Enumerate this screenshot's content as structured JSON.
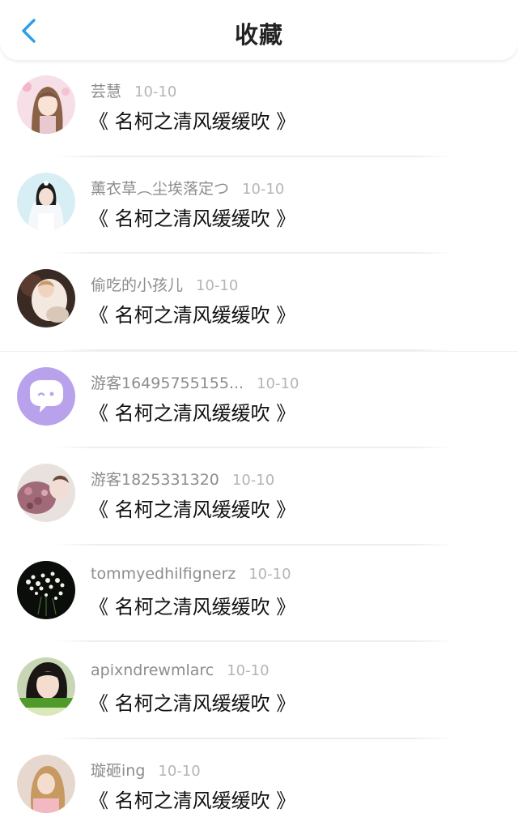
{
  "header": {
    "title": "收藏",
    "back_icon": "chevron-left-icon",
    "accent": "#2f9ee8"
  },
  "items": [
    {
      "user": "芸慧",
      "date": "10-10",
      "book": "《 名柯之清风缓缓吹 》",
      "avatar_icon": "pink-anime-avatar-icon"
    },
    {
      "user": "薰衣草︵尘埃落定つ",
      "date": "10-10",
      "book": "《 名柯之清风缓缓吹 》",
      "avatar_icon": "bride-photo-avatar-icon"
    },
    {
      "user": "偷吃的小孩儿",
      "date": "10-10",
      "book": "《 名柯之清风缓缓吹 》",
      "avatar_icon": "child-photo-avatar-icon"
    },
    {
      "user": "游客16495755155...",
      "date": "10-10",
      "book": "《 名柯之清风缓缓吹 》",
      "avatar_icon": "chat-bubble-avatar-icon"
    },
    {
      "user": "游客1825331320",
      "date": "10-10",
      "book": "《 名柯之清风缓缓吹 》",
      "avatar_icon": "flowers-photo-avatar-icon"
    },
    {
      "user": "tommyedhilfignerz",
      "date": "10-10",
      "book": "《 名柯之清风缓缓吹 》",
      "avatar_icon": "white-flowers-avatar-icon"
    },
    {
      "user": "apixndrewmlarc",
      "date": "10-10",
      "book": "《 名柯之清风缓缓吹 》",
      "avatar_icon": "girl-photo-avatar-icon"
    },
    {
      "user": "璇砸ing",
      "date": "10-10",
      "book": "《 名柯之清风缓缓吹 》",
      "avatar_icon": "blonde-girl-avatar-icon"
    }
  ]
}
